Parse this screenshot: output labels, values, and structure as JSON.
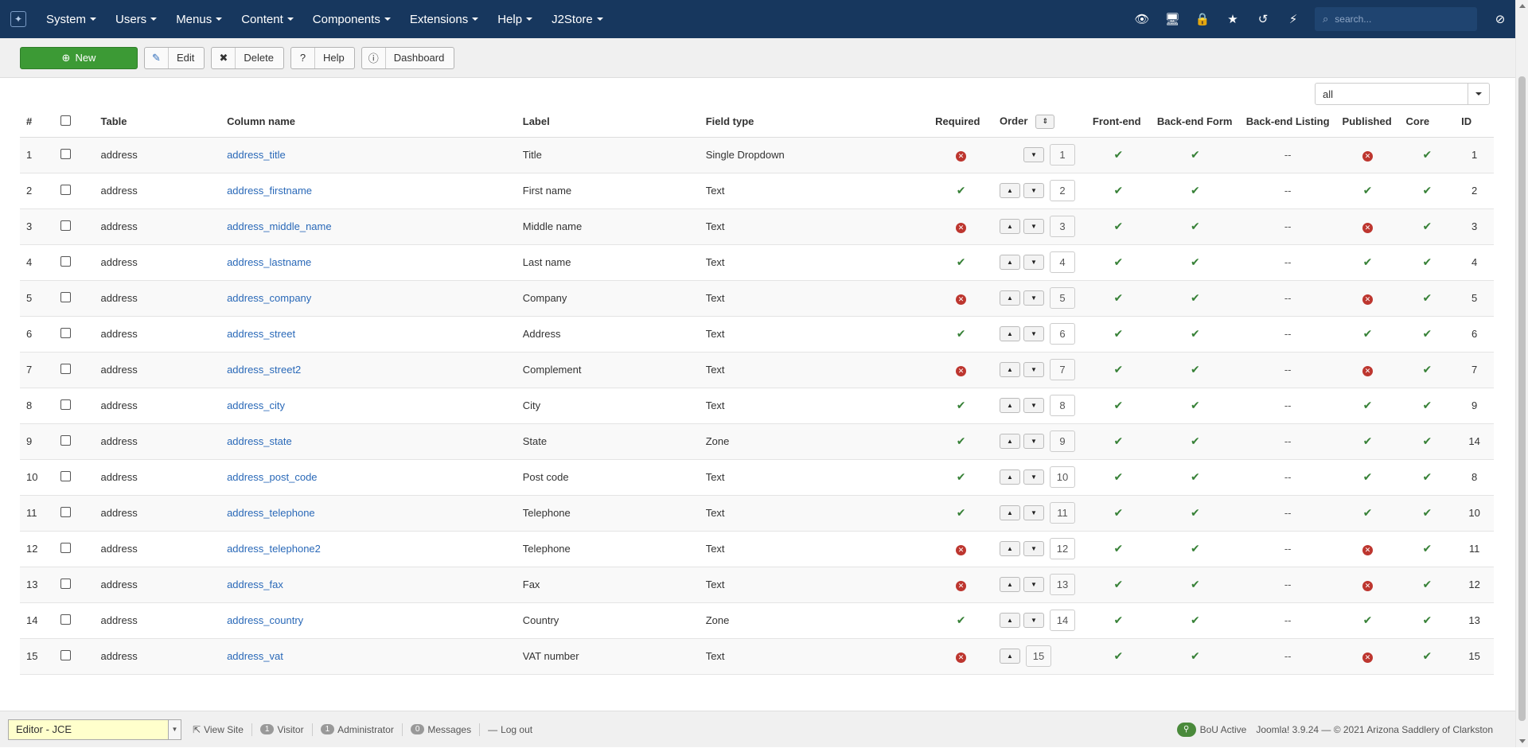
{
  "topnav": {
    "menu": [
      "System",
      "Users",
      "Menus",
      "Content",
      "Components",
      "Extensions",
      "Help",
      "J2Store"
    ],
    "search_placeholder": "search..."
  },
  "toolbar": {
    "new_label": "New",
    "edit_label": "Edit",
    "delete_label": "Delete",
    "help_label": "Help",
    "dashboard_label": "Dashboard"
  },
  "filter": {
    "value": "all"
  },
  "table": {
    "headers": {
      "num": "#",
      "table": "Table",
      "column": "Column name",
      "label": "Label",
      "fieldtype": "Field type",
      "required": "Required",
      "order": "Order",
      "frontend": "Front-end",
      "backend_form": "Back-end Form",
      "backend_listing": "Back-end Listing",
      "published": "Published",
      "core": "Core",
      "id": "ID"
    },
    "rows": [
      {
        "num": "1",
        "table": "address",
        "column": "address_title",
        "label": "Title",
        "fieldtype": "Single Dropdown",
        "required": false,
        "order": "1",
        "published": false,
        "id": "1"
      },
      {
        "num": "2",
        "table": "address",
        "column": "address_firstname",
        "label": "First name",
        "fieldtype": "Text",
        "required": true,
        "order": "2",
        "published": true,
        "id": "2"
      },
      {
        "num": "3",
        "table": "address",
        "column": "address_middle_name",
        "label": "Middle name",
        "fieldtype": "Text",
        "required": false,
        "order": "3",
        "published": false,
        "id": "3"
      },
      {
        "num": "4",
        "table": "address",
        "column": "address_lastname",
        "label": "Last name",
        "fieldtype": "Text",
        "required": true,
        "order": "4",
        "published": true,
        "id": "4"
      },
      {
        "num": "5",
        "table": "address",
        "column": "address_company",
        "label": "Company",
        "fieldtype": "Text",
        "required": false,
        "order": "5",
        "published": false,
        "id": "5"
      },
      {
        "num": "6",
        "table": "address",
        "column": "address_street",
        "label": "Address",
        "fieldtype": "Text",
        "required": true,
        "order": "6",
        "published": true,
        "id": "6"
      },
      {
        "num": "7",
        "table": "address",
        "column": "address_street2",
        "label": "Complement",
        "fieldtype": "Text",
        "required": false,
        "order": "7",
        "published": false,
        "id": "7"
      },
      {
        "num": "8",
        "table": "address",
        "column": "address_city",
        "label": "City",
        "fieldtype": "Text",
        "required": true,
        "order": "8",
        "published": true,
        "id": "9"
      },
      {
        "num": "9",
        "table": "address",
        "column": "address_state",
        "label": "State",
        "fieldtype": "Zone",
        "required": true,
        "order": "9",
        "published": true,
        "id": "14"
      },
      {
        "num": "10",
        "table": "address",
        "column": "address_post_code",
        "label": "Post code",
        "fieldtype": "Text",
        "required": true,
        "order": "10",
        "published": true,
        "id": "8"
      },
      {
        "num": "11",
        "table": "address",
        "column": "address_telephone",
        "label": "Telephone",
        "fieldtype": "Text",
        "required": true,
        "order": "11",
        "published": true,
        "id": "10"
      },
      {
        "num": "12",
        "table": "address",
        "column": "address_telephone2",
        "label": "Telephone",
        "fieldtype": "Text",
        "required": false,
        "order": "12",
        "published": false,
        "id": "11"
      },
      {
        "num": "13",
        "table": "address",
        "column": "address_fax",
        "label": "Fax",
        "fieldtype": "Text",
        "required": false,
        "order": "13",
        "published": false,
        "id": "12"
      },
      {
        "num": "14",
        "table": "address",
        "column": "address_country",
        "label": "Country",
        "fieldtype": "Zone",
        "required": true,
        "order": "14",
        "published": true,
        "id": "13"
      },
      {
        "num": "15",
        "table": "address",
        "column": "address_vat",
        "label": "VAT number",
        "fieldtype": "Text",
        "required": false,
        "order": "15",
        "published": false,
        "id": "15"
      }
    ],
    "dash": "--"
  },
  "statusbar": {
    "editor": "Editor - JCE",
    "view_site": "View Site",
    "visitor_count": "1",
    "visitor_label": "Visitor",
    "admin_count": "1",
    "admin_label": "Administrator",
    "messages_count": "0",
    "messages_label": "Messages",
    "logout": "Log out",
    "bou": "BoU Active",
    "footer": "Joomla! 3.9.24 — © 2021 Arizona Saddlery of Clarkston"
  },
  "colors": {
    "topbar": "#17375e",
    "success": "#3c9a35",
    "check": "#378137",
    "error": "#bd362f",
    "link": "#2a69b8"
  }
}
